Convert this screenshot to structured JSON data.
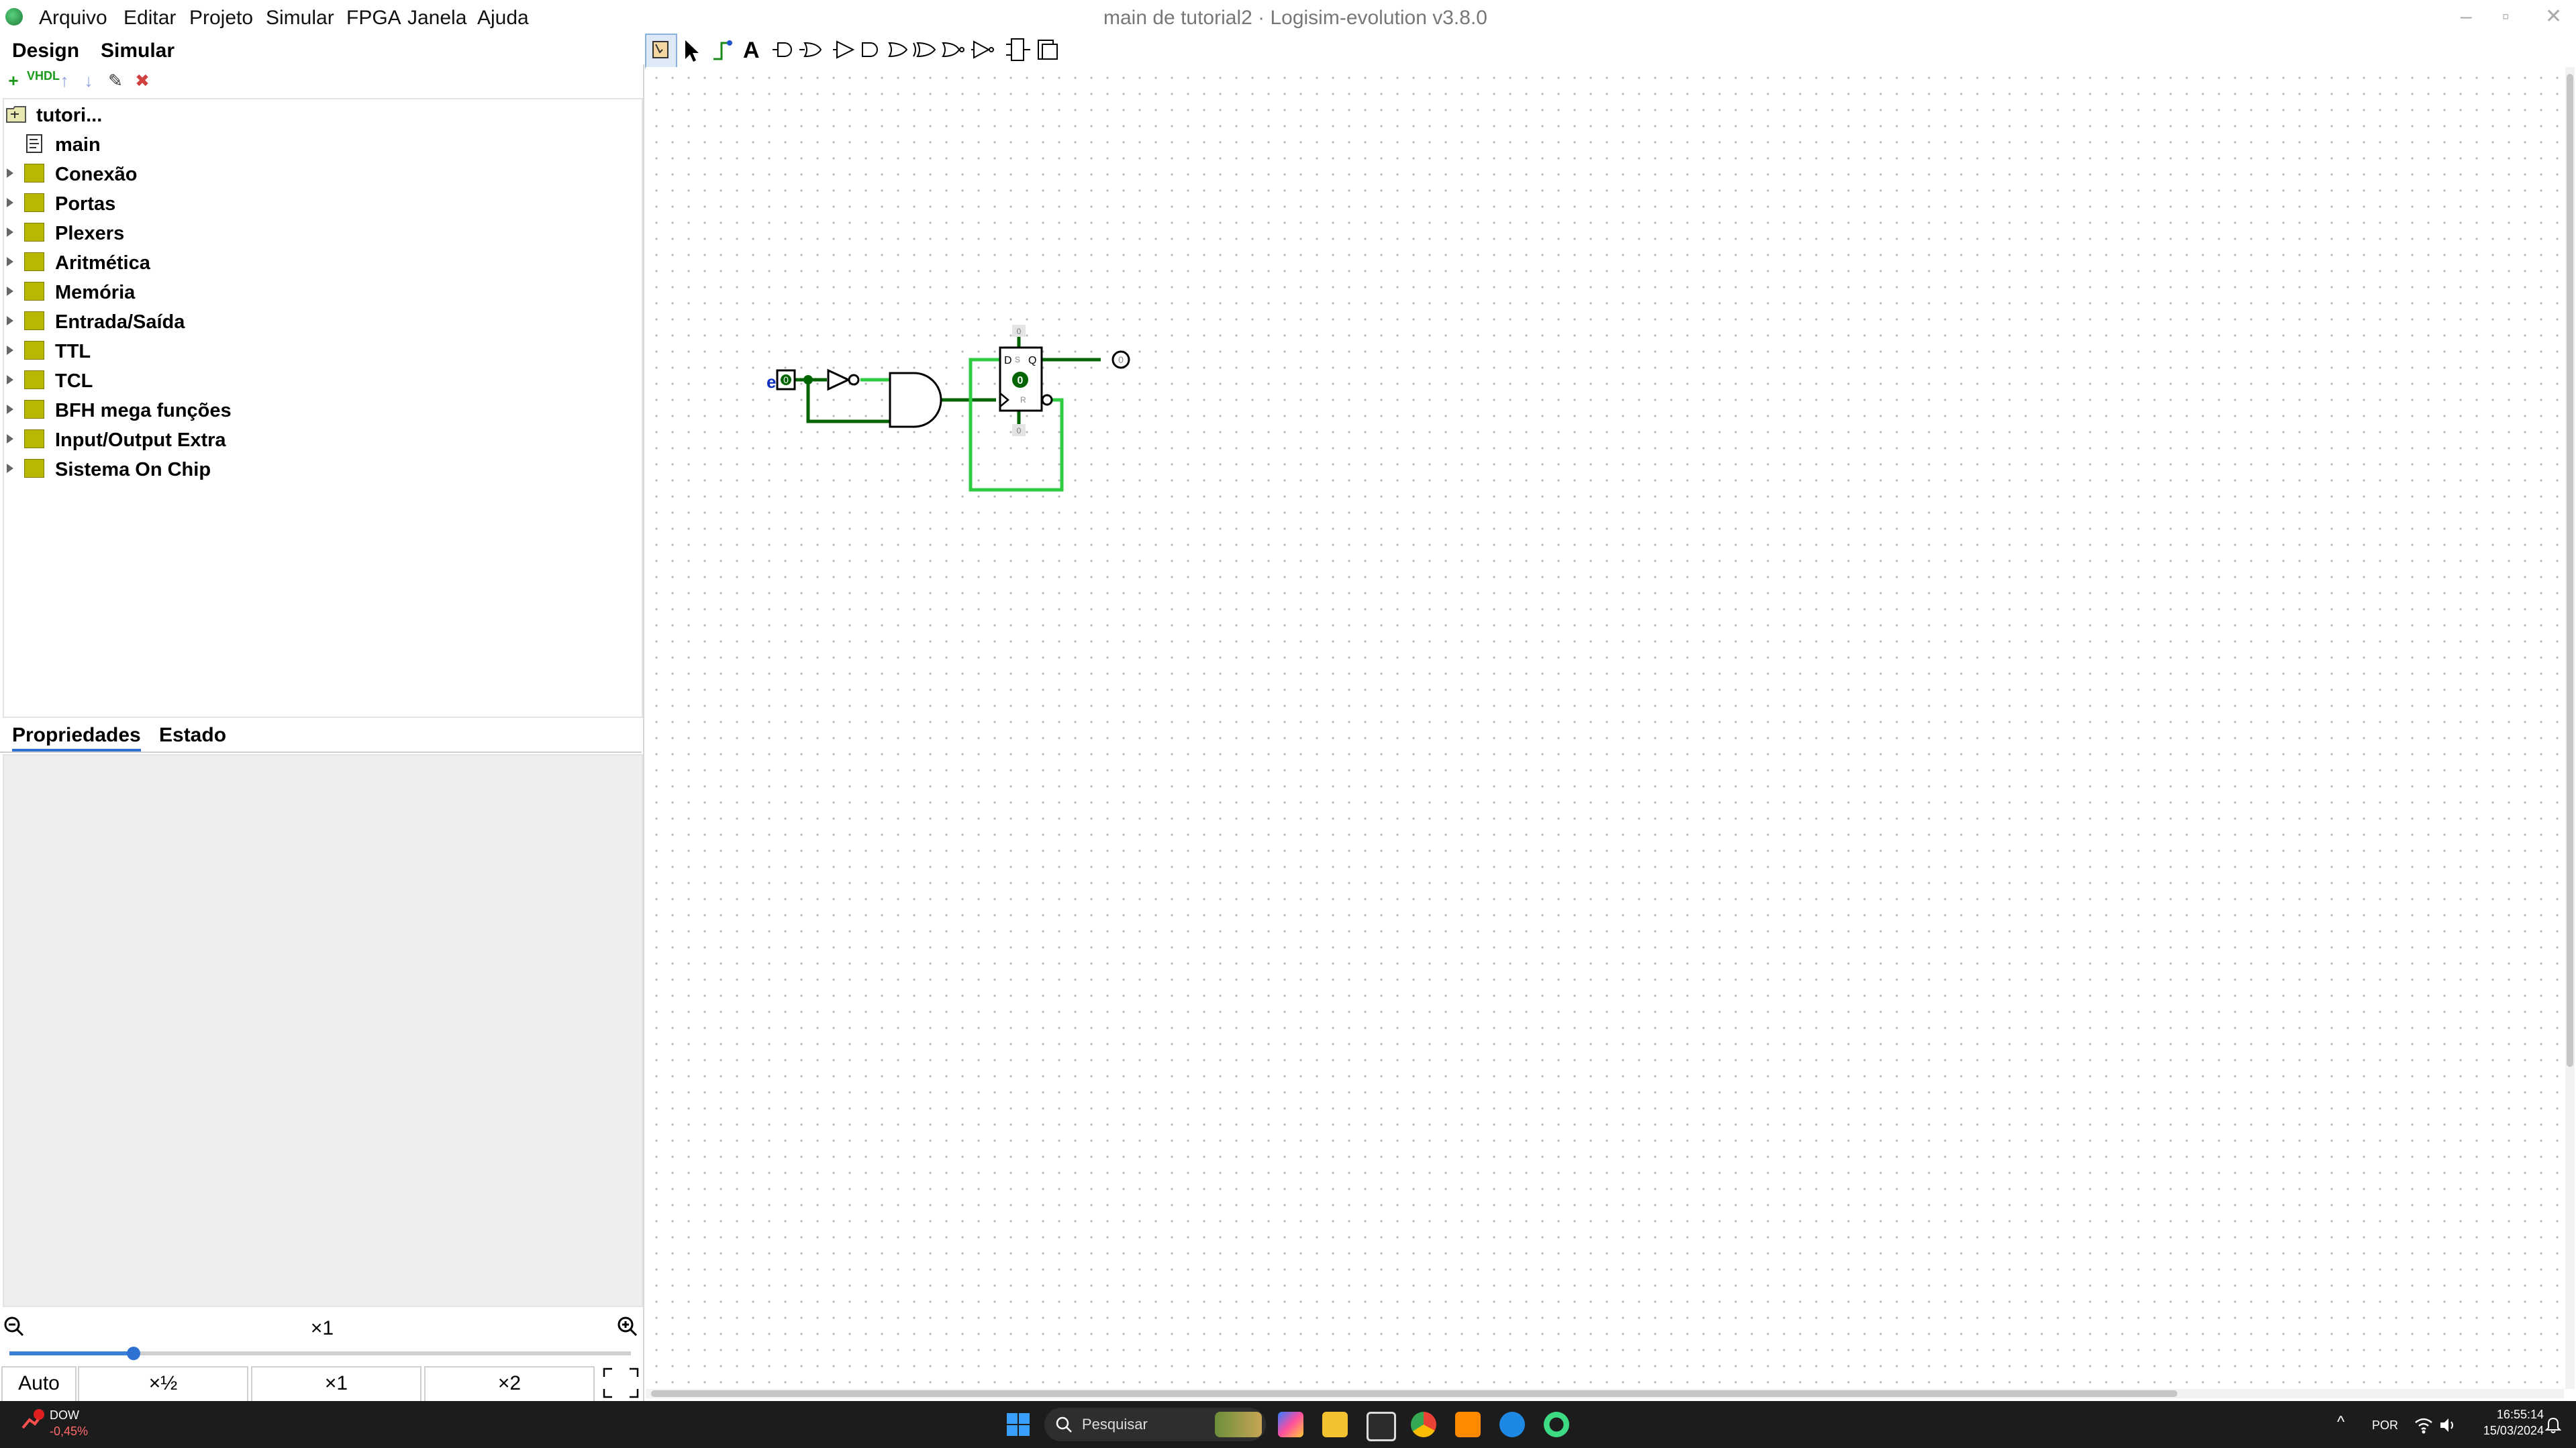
{
  "window": {
    "title": "main de tutorial2 · Logisim-evolution v3.8.0",
    "controls": [
      "–",
      "▫",
      "✕"
    ]
  },
  "menu": [
    "Arquivo",
    "Editar",
    "Projeto",
    "Simular",
    "FPGA",
    "Janela",
    "Ajuda"
  ],
  "top_tabs": [
    "Design",
    "Simular"
  ],
  "lib_toolbar": {
    "add": "+",
    "vhdl": "VHDL",
    "up": "↑",
    "down": "↓",
    "edit": "✎",
    "remove": "✖"
  },
  "tree": {
    "project": "tutori...",
    "circuit": "main",
    "libraries": [
      "Conexão",
      "Portas",
      "Plexers",
      "Aritmética",
      "Memória",
      "Entrada/Saída",
      "TTL",
      "TCL",
      "BFH mega funções",
      "Input/Output Extra",
      "Sistema On Chip"
    ]
  },
  "panel_tabs": [
    "Propriedades",
    "Estado"
  ],
  "zoom": {
    "label": "×1",
    "level": 0.2,
    "buttons": [
      "Auto",
      "×½",
      "×1",
      "×2"
    ]
  },
  "circuit": {
    "input_label": "e",
    "input_value": "0",
    "ff_d": "D",
    "ff_s": "S",
    "ff_q": "Q",
    "ff_r": "R",
    "ff_state": "0",
    "ff_top": "0",
    "ff_bottom": "0",
    "output_value": "0",
    "wire_active": "#2ecc40",
    "wire_dark": "#006400"
  },
  "taskbar": {
    "stock_name": "DOW",
    "stock_change": "-0,45%",
    "search_placeholder": "Pesquisar",
    "lang": "POR",
    "time": "16:55:14",
    "date": "15/03/2024"
  }
}
